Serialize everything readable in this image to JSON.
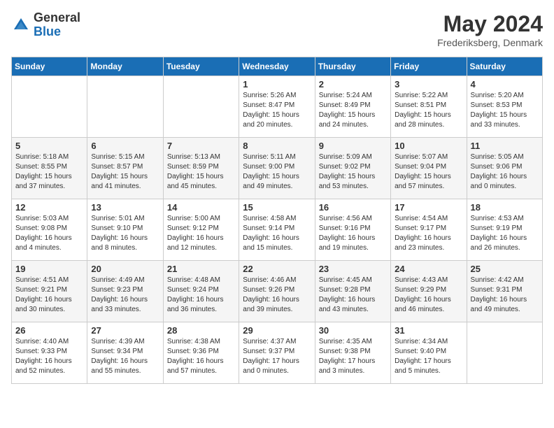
{
  "header": {
    "logo": {
      "general": "General",
      "blue": "Blue"
    },
    "title": "May 2024",
    "location": "Frederiksberg, Denmark"
  },
  "weekdays": [
    "Sunday",
    "Monday",
    "Tuesday",
    "Wednesday",
    "Thursday",
    "Friday",
    "Saturday"
  ],
  "weeks": [
    [
      {
        "day": "",
        "info": ""
      },
      {
        "day": "",
        "info": ""
      },
      {
        "day": "",
        "info": ""
      },
      {
        "day": "1",
        "info": "Sunrise: 5:26 AM\nSunset: 8:47 PM\nDaylight: 15 hours\nand 20 minutes."
      },
      {
        "day": "2",
        "info": "Sunrise: 5:24 AM\nSunset: 8:49 PM\nDaylight: 15 hours\nand 24 minutes."
      },
      {
        "day": "3",
        "info": "Sunrise: 5:22 AM\nSunset: 8:51 PM\nDaylight: 15 hours\nand 28 minutes."
      },
      {
        "day": "4",
        "info": "Sunrise: 5:20 AM\nSunset: 8:53 PM\nDaylight: 15 hours\nand 33 minutes."
      }
    ],
    [
      {
        "day": "5",
        "info": "Sunrise: 5:18 AM\nSunset: 8:55 PM\nDaylight: 15 hours\nand 37 minutes."
      },
      {
        "day": "6",
        "info": "Sunrise: 5:15 AM\nSunset: 8:57 PM\nDaylight: 15 hours\nand 41 minutes."
      },
      {
        "day": "7",
        "info": "Sunrise: 5:13 AM\nSunset: 8:59 PM\nDaylight: 15 hours\nand 45 minutes."
      },
      {
        "day": "8",
        "info": "Sunrise: 5:11 AM\nSunset: 9:00 PM\nDaylight: 15 hours\nand 49 minutes."
      },
      {
        "day": "9",
        "info": "Sunrise: 5:09 AM\nSunset: 9:02 PM\nDaylight: 15 hours\nand 53 minutes."
      },
      {
        "day": "10",
        "info": "Sunrise: 5:07 AM\nSunset: 9:04 PM\nDaylight: 15 hours\nand 57 minutes."
      },
      {
        "day": "11",
        "info": "Sunrise: 5:05 AM\nSunset: 9:06 PM\nDaylight: 16 hours\nand 0 minutes."
      }
    ],
    [
      {
        "day": "12",
        "info": "Sunrise: 5:03 AM\nSunset: 9:08 PM\nDaylight: 16 hours\nand 4 minutes."
      },
      {
        "day": "13",
        "info": "Sunrise: 5:01 AM\nSunset: 9:10 PM\nDaylight: 16 hours\nand 8 minutes."
      },
      {
        "day": "14",
        "info": "Sunrise: 5:00 AM\nSunset: 9:12 PM\nDaylight: 16 hours\nand 12 minutes."
      },
      {
        "day": "15",
        "info": "Sunrise: 4:58 AM\nSunset: 9:14 PM\nDaylight: 16 hours\nand 15 minutes."
      },
      {
        "day": "16",
        "info": "Sunrise: 4:56 AM\nSunset: 9:16 PM\nDaylight: 16 hours\nand 19 minutes."
      },
      {
        "day": "17",
        "info": "Sunrise: 4:54 AM\nSunset: 9:17 PM\nDaylight: 16 hours\nand 23 minutes."
      },
      {
        "day": "18",
        "info": "Sunrise: 4:53 AM\nSunset: 9:19 PM\nDaylight: 16 hours\nand 26 minutes."
      }
    ],
    [
      {
        "day": "19",
        "info": "Sunrise: 4:51 AM\nSunset: 9:21 PM\nDaylight: 16 hours\nand 30 minutes."
      },
      {
        "day": "20",
        "info": "Sunrise: 4:49 AM\nSunset: 9:23 PM\nDaylight: 16 hours\nand 33 minutes."
      },
      {
        "day": "21",
        "info": "Sunrise: 4:48 AM\nSunset: 9:24 PM\nDaylight: 16 hours\nand 36 minutes."
      },
      {
        "day": "22",
        "info": "Sunrise: 4:46 AM\nSunset: 9:26 PM\nDaylight: 16 hours\nand 39 minutes."
      },
      {
        "day": "23",
        "info": "Sunrise: 4:45 AM\nSunset: 9:28 PM\nDaylight: 16 hours\nand 43 minutes."
      },
      {
        "day": "24",
        "info": "Sunrise: 4:43 AM\nSunset: 9:29 PM\nDaylight: 16 hours\nand 46 minutes."
      },
      {
        "day": "25",
        "info": "Sunrise: 4:42 AM\nSunset: 9:31 PM\nDaylight: 16 hours\nand 49 minutes."
      }
    ],
    [
      {
        "day": "26",
        "info": "Sunrise: 4:40 AM\nSunset: 9:33 PM\nDaylight: 16 hours\nand 52 minutes."
      },
      {
        "day": "27",
        "info": "Sunrise: 4:39 AM\nSunset: 9:34 PM\nDaylight: 16 hours\nand 55 minutes."
      },
      {
        "day": "28",
        "info": "Sunrise: 4:38 AM\nSunset: 9:36 PM\nDaylight: 16 hours\nand 57 minutes."
      },
      {
        "day": "29",
        "info": "Sunrise: 4:37 AM\nSunset: 9:37 PM\nDaylight: 17 hours\nand 0 minutes."
      },
      {
        "day": "30",
        "info": "Sunrise: 4:35 AM\nSunset: 9:38 PM\nDaylight: 17 hours\nand 3 minutes."
      },
      {
        "day": "31",
        "info": "Sunrise: 4:34 AM\nSunset: 9:40 PM\nDaylight: 17 hours\nand 5 minutes."
      },
      {
        "day": "",
        "info": ""
      }
    ]
  ]
}
